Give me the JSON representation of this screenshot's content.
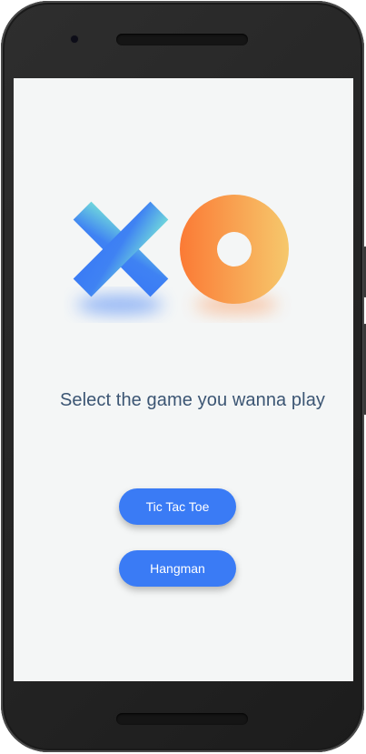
{
  "screen": {
    "title": "Select the game you wanna play",
    "buttons": [
      {
        "label": "Tic Tac Toe"
      },
      {
        "label": "Hangman"
      }
    ]
  },
  "logo": {
    "x_icon": "x-mark-icon",
    "o_icon": "o-ring-icon",
    "x_gradient": [
      "#3a7bf5",
      "#6fd6dc"
    ],
    "o_gradient": [
      "#fb7a35",
      "#f6c86c"
    ]
  },
  "colors": {
    "button": "#3a7bf5",
    "title": "#3b5573",
    "background": "#f4f6f6"
  }
}
